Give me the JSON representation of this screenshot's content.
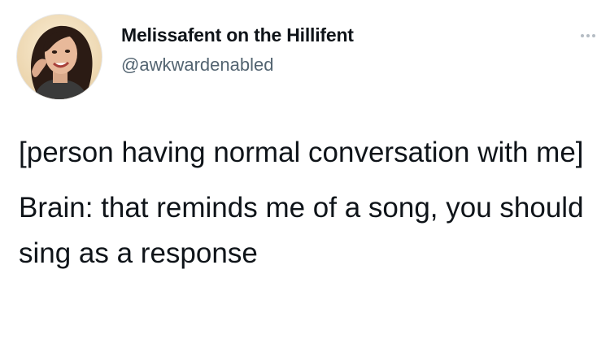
{
  "author": {
    "display_name": "Melissafent on the Hillifent",
    "handle": "@awkwardenabled"
  },
  "icons": {
    "avatar": "profile-photo",
    "more": "more-options-icon"
  },
  "tweet": {
    "paragraphs": [
      "[person having normal conversation with me]",
      "Brain: that reminds me of a song, you should sing as a response"
    ]
  },
  "colors": {
    "text_primary": "#0f1419",
    "text_secondary": "#536471",
    "background": "#ffffff"
  }
}
